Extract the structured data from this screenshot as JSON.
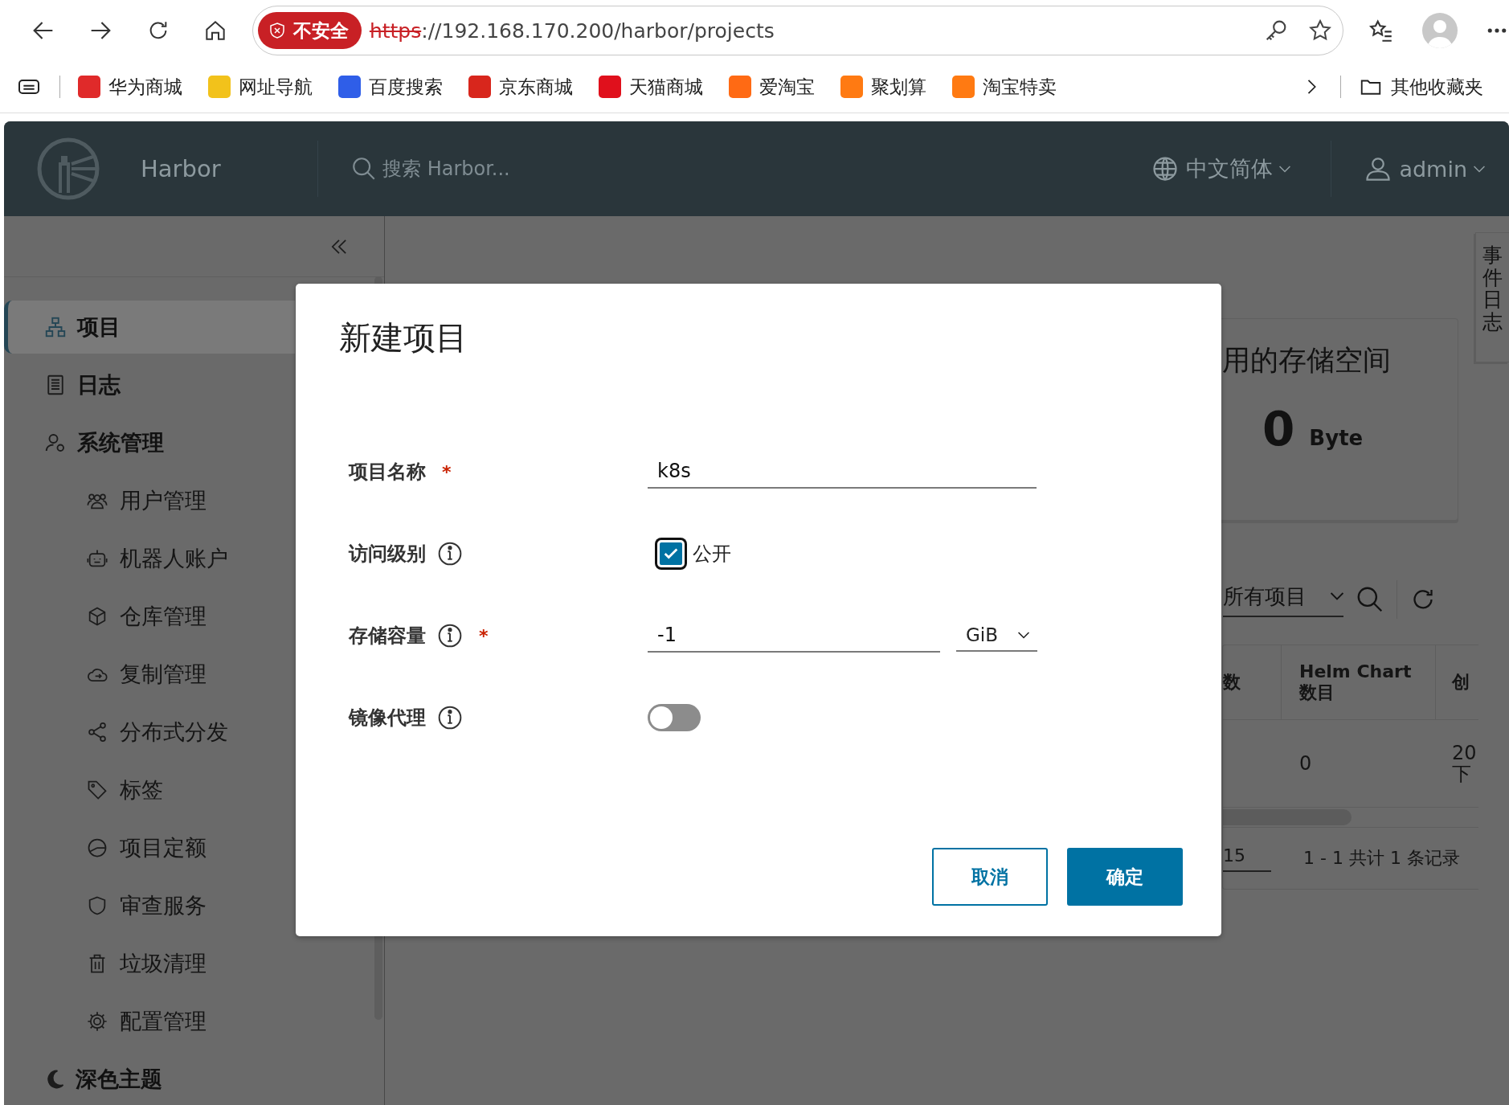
{
  "browser": {
    "security_badge": "不安全",
    "url_scheme": "https",
    "url_rest": "://192.168.170.200/harbor/projects",
    "bookmarks": [
      {
        "label": "华为商城",
        "color": "#e02a2a"
      },
      {
        "label": "网址导航",
        "color": "#f2c21b"
      },
      {
        "label": "百度搜索",
        "color": "#2f5ee8"
      },
      {
        "label": "京东商城",
        "color": "#d8261c"
      },
      {
        "label": "天猫商城",
        "color": "#e0101c"
      },
      {
        "label": "爱淘宝",
        "color": "#ff6a14"
      },
      {
        "label": "聚划算",
        "color": "#ff7a12"
      },
      {
        "label": "淘宝特卖",
        "color": "#ff7a12"
      }
    ],
    "other_bookmarks": "其他收藏夹"
  },
  "header": {
    "brand": "Harbor",
    "search_placeholder": "搜索 Harbor...",
    "language": "中文简体",
    "user": "admin"
  },
  "sidebar": {
    "items": [
      {
        "label": "项目",
        "selected": true
      },
      {
        "label": "日志",
        "selected": false
      },
      {
        "label": "系统管理",
        "selected": false,
        "children": [
          {
            "label": "用户管理",
            "selected": false
          },
          {
            "label": "机器人账户",
            "selected": false
          },
          {
            "label": "仓库管理",
            "selected": false
          },
          {
            "label": "复制管理",
            "selected": false
          },
          {
            "label": "分布式分发",
            "selected": false
          },
          {
            "label": "标签",
            "selected": false
          },
          {
            "label": "项目定额",
            "selected": false
          },
          {
            "label": "审查服务",
            "selected": false
          },
          {
            "label": "垃圾清理",
            "selected": false
          },
          {
            "label": "配置管理",
            "selected": false
          }
        ]
      }
    ],
    "theme_toggle": "深色主题"
  },
  "main": {
    "storage_card": {
      "title": "用的存储空间",
      "value": "0",
      "unit": "Byte"
    },
    "filter": "所有项目",
    "table": {
      "columns": [
        "数",
        "Helm Chart 数目",
        "创"
      ],
      "rows": [
        [
          "",
          "0",
          "20\n下"
        ]
      ],
      "page_size": "15",
      "summary": "1 - 1 共计 1 条记录"
    },
    "event_log_tab": "事件日志"
  },
  "dialog": {
    "title": "新建项目",
    "fields": [
      {
        "kind": "text",
        "label": "项目名称",
        "required_marker": "*",
        "info": false,
        "value": "k8s"
      },
      {
        "kind": "checkbox",
        "label": "访问级别",
        "info": true,
        "checked": true,
        "option": "公开"
      },
      {
        "kind": "quota",
        "label": "存储容量",
        "required_marker": "*",
        "info": true,
        "value": "-1",
        "unit": "GiB"
      },
      {
        "kind": "toggle",
        "label": "镜像代理",
        "info": true,
        "on": false
      }
    ],
    "buttons": [
      {
        "label": "取消",
        "primary": false
      },
      {
        "label": "确定",
        "primary": true
      }
    ]
  }
}
